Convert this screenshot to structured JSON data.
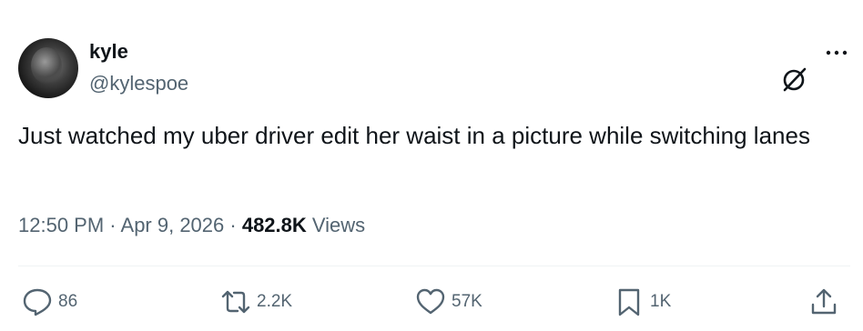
{
  "author": {
    "name": "kyle",
    "handle": "@kylespoe"
  },
  "tweet": {
    "text": "Just watched my uber driver edit her waist in a picture while switching lanes"
  },
  "meta": {
    "time": "12:50 PM",
    "separator1": " · ",
    "date": "Apr 9, 2026",
    "separator2": " · ",
    "views_count": "482.8K",
    "views_label": " Views"
  },
  "actions": {
    "replies": "86",
    "retweets": "2.2K",
    "likes": "57K",
    "bookmarks": "1K"
  },
  "icons": {
    "grok": "grok-icon",
    "more": "more-icon",
    "reply": "reply-icon",
    "retweet": "retweet-icon",
    "like": "heart-icon",
    "bookmark": "bookmark-icon",
    "share": "share-icon"
  },
  "colors": {
    "text": "#0f1419",
    "secondary": "#536471",
    "divider": "#eff3f4"
  }
}
